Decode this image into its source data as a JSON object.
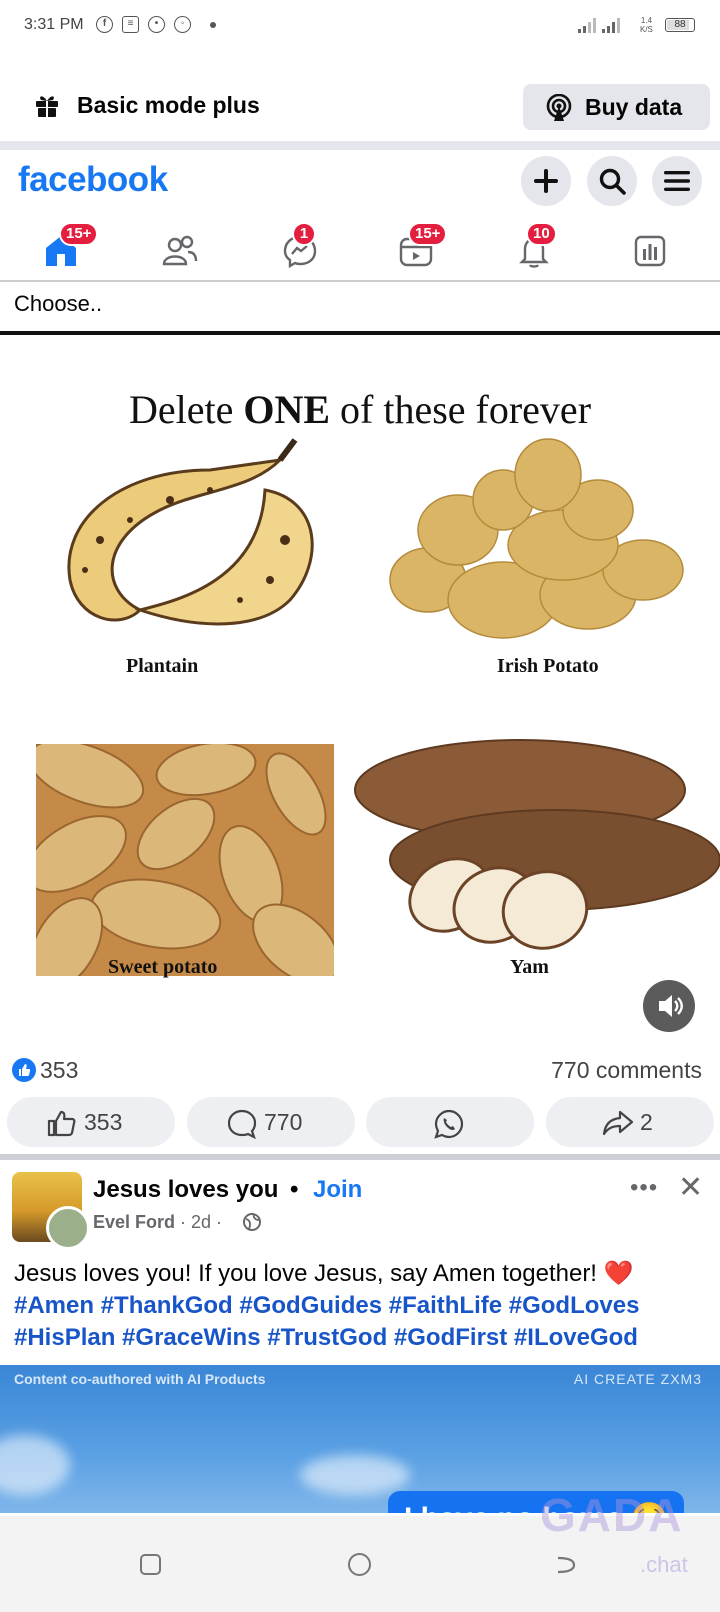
{
  "status_bar": {
    "time": "3:31 PM",
    "net_speed_value": "1.4",
    "net_speed_unit": "K/S",
    "battery": "88"
  },
  "basic_mode": {
    "title": "Basic mode plus",
    "buy_label": "Buy data"
  },
  "header": {
    "logo": "facebook"
  },
  "tabs": {
    "home_badge": "15+",
    "messenger_badge": "1",
    "video_badge": "15+",
    "notifications_badge": "10"
  },
  "choose_text": "Choose..",
  "post1": {
    "image": {
      "headline_pre": "Delete ",
      "headline_bold": "ONE",
      "headline_post": " of these forever",
      "items": [
        "Plantain",
        "Irish Potato",
        "Sweet potato",
        "Yam"
      ]
    },
    "reactions_count": "353",
    "comments_summary": "770 comments",
    "actions": {
      "like_count": "353",
      "comment_count": "770",
      "share_count": "2"
    }
  },
  "post2": {
    "group_name": "Jesus loves you",
    "separator": "•",
    "join_label": "Join",
    "author": "Evel Ford",
    "time": "2d",
    "body": "Jesus loves you! If you love Jesus, say Amen together! ",
    "heart": "❤️",
    "hashtags": "#Amen #ThankGod #GodGuides #FaithLife #GodLoves #HisPlan #GraceWins #TrustGod #GodFirst #ILoveGod",
    "image_caption_left": "Content co-authored with AI Products",
    "image_caption_right": "AI CREATE ZXM3",
    "bubble_text": "I have no home 😢"
  },
  "watermark": {
    "brand": "GADA",
    "suffix": ".chat"
  },
  "colors": {
    "facebook_blue": "#1877f2",
    "badge_red": "#e41e3f",
    "hashtag_blue": "#1855c9"
  }
}
